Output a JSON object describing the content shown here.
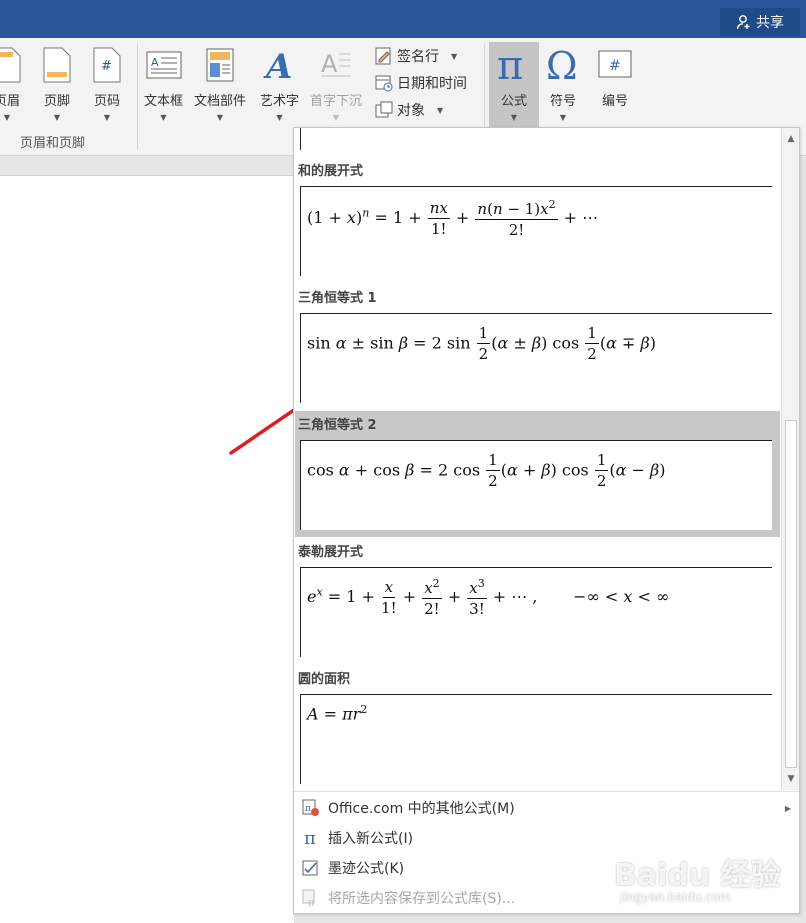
{
  "titlebar": {
    "share_label": "共享"
  },
  "ribbon": {
    "header_footer_group": {
      "items": [
        {
          "label": "页眉"
        },
        {
          "label": "页脚"
        },
        {
          "label": "页码"
        }
      ],
      "group_label": "页眉和页脚"
    },
    "text_group": {
      "textbox": "文本框",
      "quickparts": "文档部件",
      "wordart": "艺术字",
      "dropcap": "首字下沉",
      "signature_line": "签名行",
      "datetime": "日期和时间",
      "object": "对象"
    },
    "symbols_group": {
      "equation": "公式",
      "symbol": "符号",
      "number": "编号"
    }
  },
  "gallery": {
    "equations": [
      {
        "heading": "和的展开式"
      },
      {
        "heading": "三角恒等式 1"
      },
      {
        "heading": "三角恒等式 2",
        "selected": true
      },
      {
        "heading": "泰勒展开式"
      },
      {
        "heading": "圆的面积"
      }
    ],
    "menu": [
      {
        "label": "Office.com 中的其他公式(M)",
        "icon": "office-equation-icon",
        "enabled": true,
        "submenu": true
      },
      {
        "label": "插入新公式(I)",
        "icon": "pi-icon",
        "enabled": true
      },
      {
        "label": "墨迹公式(K)",
        "icon": "ink-equation-icon",
        "enabled": true
      },
      {
        "label": "将所选内容保存到公式库(S)...",
        "icon": "save-equation-icon",
        "enabled": false
      }
    ]
  },
  "watermark": {
    "brand": "Baidu 经验",
    "url": "jingyan.baidu.com"
  },
  "colors": {
    "title_blue": "#2b579a",
    "accent_red": "#e02020",
    "pi_blue": "#3a6ab0"
  }
}
